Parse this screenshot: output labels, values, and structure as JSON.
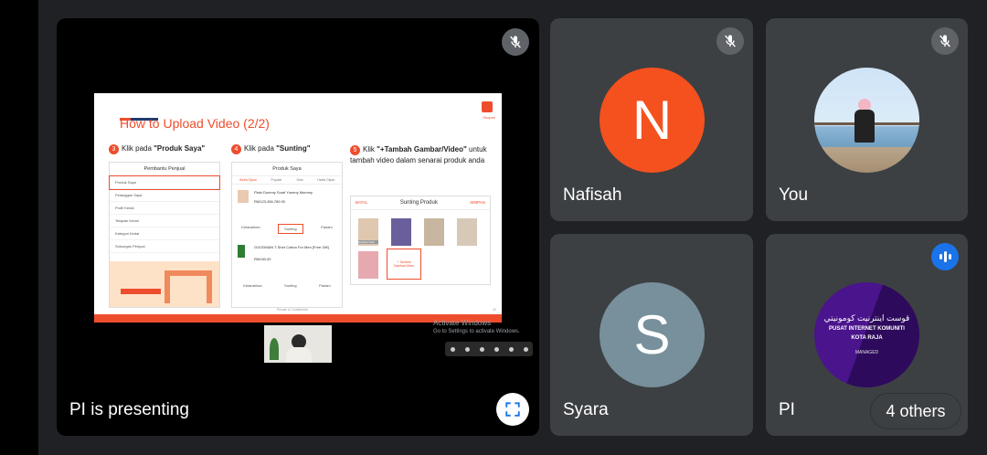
{
  "colors": {
    "background": "#202124",
    "tile": "#3c4043",
    "accent": "#ee4d2d",
    "speaking": "#1a73e8"
  },
  "main_tile": {
    "presenter_label": "PI is presenting",
    "fullscreen_icon": "fullscreen-icon",
    "mute_icon": "mic-off-icon",
    "windows_notice": {
      "title": "Activate Windows",
      "subtitle": "Go to Settings to activate Windows."
    },
    "slide": {
      "title": "How to Upload Video (2/2)",
      "brand": "Shopee",
      "footer": "Private & Confidential",
      "page": "43",
      "steps": [
        {
          "num": "3",
          "prefix": "Klik pada ",
          "bold": "\"Produk Saya\""
        },
        {
          "num": "4",
          "prefix": "Klik pada ",
          "bold": "\"Sunting\""
        },
        {
          "num": "5",
          "prefix": "Klik ",
          "bold": "\"+Tambah Gambar/Video\"",
          "suffix": " untuk tambah video dalam senarai produk anda"
        }
      ],
      "phone1": {
        "header": "Pembantu Penjual",
        "items": [
          "Produk Saya",
          "Pelanggan Saya",
          "Profil Kedai",
          "Tetapan Kedai",
          "Kategori Kedai",
          "Sokongan Penjual"
        ]
      },
      "phone2": {
        "header": "Produk Saya",
        "tabs": [
          "Sedia Dijual",
          "Populer",
          "Stok",
          "Habis Dijual"
        ],
        "product1": "Plain Dummy Scarf Yummy Mummy",
        "price1": "RM123,456,789.00",
        "product2": "GOODMAN T-Shirt Cotton For Men [Free Gift]",
        "price2": "RM150.00",
        "actions": [
          "Ketarahkan",
          "Sunting",
          "Padam"
        ]
      },
      "phone3": {
        "header": "Sunting Produk",
        "left": "BATAL",
        "right": "SIMPAN",
        "add_label": "+ Tambah Gambar/Video",
        "cover_label": "Gambar Kulit"
      }
    }
  },
  "participants": [
    {
      "name": "Nafisah",
      "initial": "N",
      "color": "#f4511e",
      "muted": true
    },
    {
      "name": "You",
      "muted": true,
      "photo": true
    },
    {
      "name": "Syara",
      "initial": "S",
      "color": "#78909c",
      "muted": false
    },
    {
      "name": "PI",
      "speaking": true,
      "logo_lines": [
        "قوست اينترنيت كومونيتي",
        "PUSAT INTERNET KOMUNITI",
        "KOTA RAJA",
        "MANAGED"
      ]
    }
  ],
  "others_label": "4 others"
}
